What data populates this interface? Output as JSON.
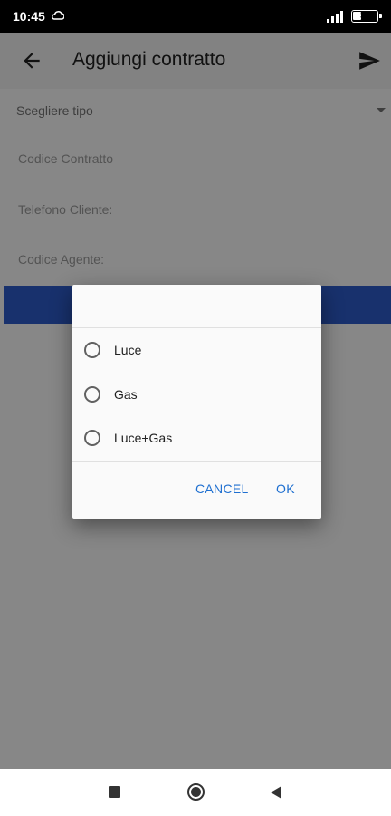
{
  "status_bar": {
    "time": "10:45",
    "battery": "37",
    "battery_level": 0.37
  },
  "app_bar": {
    "title": "Aggiungi contratto",
    "back_icon": "arrow-back-icon",
    "send_icon": "send-icon"
  },
  "form": {
    "select_label": "Scegliere tipo",
    "contract_code_placeholder": "Codice Contratto",
    "customer_phone_placeholder": "Telefono Cliente:",
    "agent_code_placeholder": "Codice Agente:",
    "submit_button_color": "#2f5ecf"
  },
  "dialog": {
    "options": [
      {
        "label": "Luce",
        "selected": false
      },
      {
        "label": "Gas",
        "selected": false
      },
      {
        "label": "Luce+Gas",
        "selected": false
      }
    ],
    "cancel_label": "CANCEL",
    "ok_label": "OK",
    "accent_color": "#1e6fd0"
  },
  "nav_bar": {
    "recents_icon": "square-icon",
    "home_icon": "circle-home-icon",
    "back_icon": "triangle-back-icon"
  }
}
